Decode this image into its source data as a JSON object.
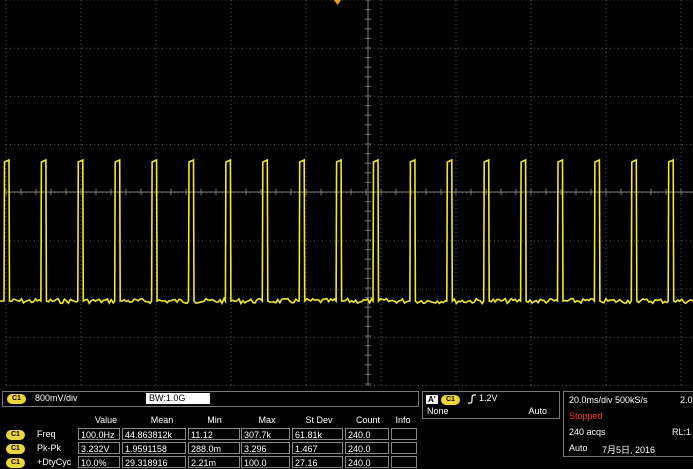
{
  "display": {
    "colors": {
      "trace": "#f2e72c",
      "graticule": "#555555",
      "background": "#000000",
      "stopped": "#ff2a2a"
    },
    "trigger_marker": "orange-triangle",
    "waveform": {
      "type": "pulse-train",
      "pulse_count": 21
    }
  },
  "channel": {
    "badge": "C1",
    "scale": "800mV/div",
    "bandwidth": "BW:1.0G"
  },
  "measurements": {
    "headers": [
      "Value",
      "Mean",
      "Min",
      "Max",
      "St Dev",
      "Count",
      "Info"
    ],
    "rows": [
      {
        "badge": "C1",
        "name": "Freq",
        "value": "100.0Hz",
        "mean": "44.863812k",
        "min": "11.12",
        "max": "307.7k",
        "stdev": "61.81k",
        "count": "240.0",
        "info": ""
      },
      {
        "badge": "C1",
        "name": "Pk-Pk",
        "value": "3.232V",
        "mean": "1.9591158",
        "min": "288.0m",
        "max": "3.296",
        "stdev": "1.467",
        "count": "240.0",
        "info": ""
      },
      {
        "badge": "C1",
        "name": "+DtyCyc",
        "value": "10.0%",
        "mean": "29.318916",
        "min": "2.21m",
        "max": "100.0",
        "stdev": "27.16",
        "count": "240.0",
        "info": ""
      }
    ]
  },
  "trigger": {
    "letter": "A'",
    "badge": "C1",
    "slope_icon": "rising-edge-icon",
    "level": "1.2V",
    "mode": "None",
    "type": "Auto"
  },
  "acquisition": {
    "timebase": "20.0ms/div 500kS/s",
    "extra": "2.0",
    "state": "Stopped",
    "acqs": "240 acqs",
    "rl": "RL:1",
    "mode": "Auto",
    "date": "7月5日, 2016"
  }
}
